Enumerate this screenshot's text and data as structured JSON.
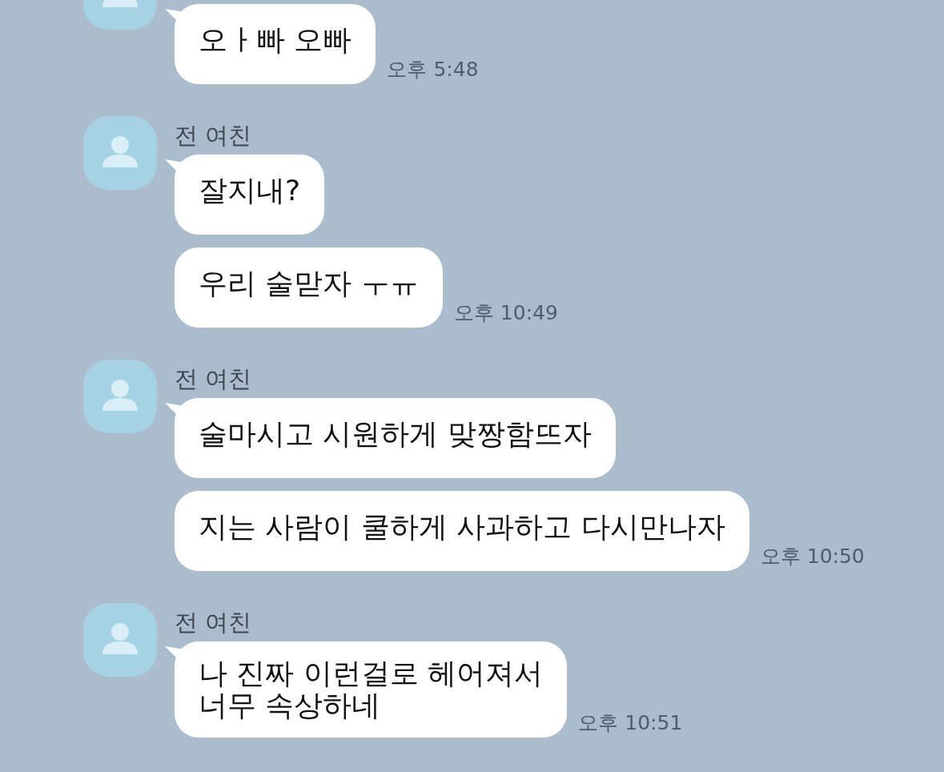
{
  "groups": [
    {
      "messages": [
        "오ㅏ빠 오빠"
      ],
      "time": "오후 5:48"
    },
    {
      "sender": "전 여친",
      "messages": [
        "잘지내?",
        "우리 술맏자 ㅜㅠ"
      ],
      "time": "오후 10:49"
    },
    {
      "sender": "전 여친",
      "messages": [
        "술마시고 시원하게 맞짱함뜨자",
        "지는 사람이 쿨하게 사과하고 다시만나자"
      ],
      "time": "오후 10:50"
    },
    {
      "sender": "전 여친",
      "messages": [
        "나 진짜 이런걸로 헤어져서\n너무 속상하네"
      ],
      "time": "오후 10:51"
    }
  ]
}
